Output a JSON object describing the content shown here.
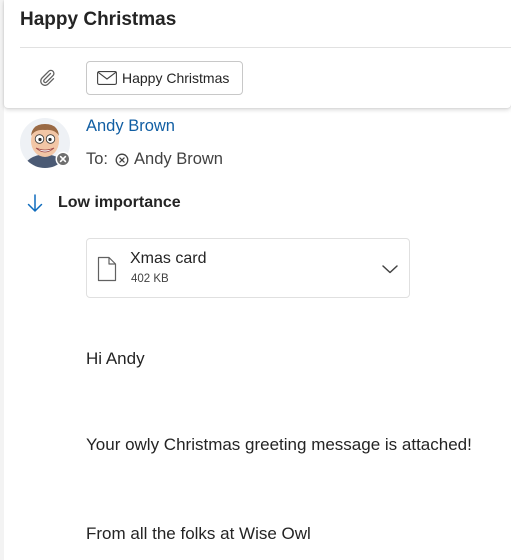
{
  "message": {
    "subject": "Happy Christmas",
    "toolbar": {
      "attach_icon": "paperclip-icon",
      "chip_icon": "envelope-icon",
      "chip_label": "Happy Christmas"
    },
    "sender": {
      "name": "Andy Brown",
      "avatar": "cartoon-avatar",
      "presence": "offline-presence-icon"
    },
    "recipients": {
      "label": "To:",
      "items": [
        {
          "name": "Andy Brown",
          "icon": "remove-circle-icon"
        }
      ]
    },
    "importance": {
      "icon": "arrow-down-icon",
      "label": "Low importance",
      "color": "#0f6cbd"
    },
    "attachment": {
      "icon": "document-icon",
      "name": "Xmas card",
      "size": "402 KB",
      "expand_icon": "chevron-down-icon"
    },
    "body": [
      "Hi Andy",
      "Your owly Christmas greeting message is attached!",
      "From all the folks at Wise Owl"
    ]
  },
  "colors": {
    "accent": "#115ea3",
    "importance_arrow": "#0f6cbd"
  }
}
